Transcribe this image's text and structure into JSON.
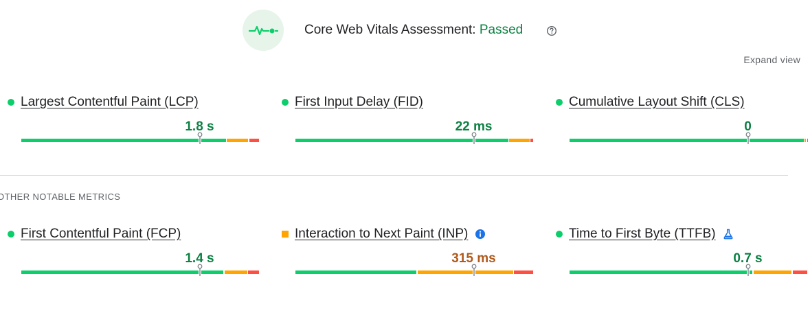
{
  "header": {
    "title": "Core Web Vitals Assessment: ",
    "status": "Passed",
    "icon": "heartbeat-icon",
    "help_icon": "help-circle-icon"
  },
  "expand_view_label": "Expand view",
  "other_section_label": "OTHER NOTABLE METRICS",
  "colors": {
    "good": "#0cce6b",
    "needs_improvement": "#ffa400",
    "poor": "#ff4e42",
    "good_text": "#0d8043",
    "ni_text": "#b05a1c"
  },
  "core_metrics": [
    {
      "name": "Largest Contentful Paint (LCP)",
      "value": "1.8 s",
      "rating": "good",
      "distribution": [
        0.86,
        0.095,
        0.045
      ],
      "percentile": 0.75
    },
    {
      "name": "First Input Delay (FID)",
      "value": "22 ms",
      "rating": "good",
      "distribution": [
        0.895,
        0.09,
        0.015
      ],
      "percentile": 0.75
    },
    {
      "name": "Cumulative Layout Shift (CLS)",
      "value": "0",
      "rating": "good",
      "distribution": [
        0.985,
        0.01,
        0.005
      ],
      "percentile": 0.75
    }
  ],
  "other_metrics": [
    {
      "name": "First Contentful Paint (FCP)",
      "value": "1.4 s",
      "rating": "good",
      "distribution": [
        0.85,
        0.1,
        0.05
      ],
      "percentile": 0.75
    },
    {
      "name": "Interaction to Next Paint (INP)",
      "value": "315 ms",
      "rating": "needs_improvement",
      "distribution": [
        0.51,
        0.405,
        0.085
      ],
      "percentile": 0.75,
      "badge": "info-icon"
    },
    {
      "name": "Time to First Byte (TTFB)",
      "value": "0.7 s",
      "rating": "good",
      "distribution": [
        0.77,
        0.165,
        0.065
      ],
      "percentile": 0.75,
      "badge": "flask-icon"
    }
  ]
}
